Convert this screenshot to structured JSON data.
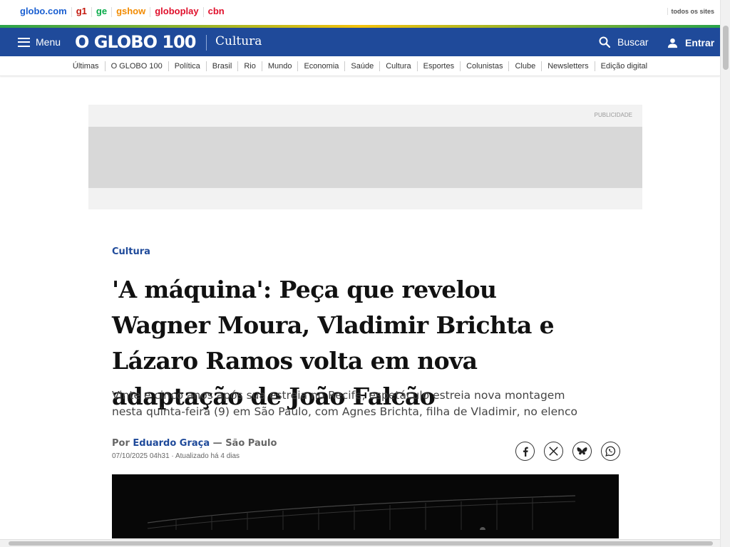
{
  "topbar": {
    "sites": [
      {
        "label": "globo.com",
        "color": "#1a5fd1"
      },
      {
        "label": "g1",
        "color": "#c4170c"
      },
      {
        "label": "ge",
        "color": "#06aa48"
      },
      {
        "label": "gshow",
        "color": "#f28b00"
      },
      {
        "label": "globoplay",
        "color": "#e0102c"
      },
      {
        "label": "cbn",
        "color": "#e0102c"
      }
    ],
    "all_sites_label": "todos os sites"
  },
  "header": {
    "menu_label": "Menu",
    "logo_text": "O GLOBO 100",
    "section_title": "Cultura",
    "search_label": "Buscar",
    "login_label": "Entrar",
    "background_color": "#1f4a9a"
  },
  "subnav": {
    "items": [
      "Últimas",
      "O GLOBO 100",
      "Política",
      "Brasil",
      "Rio",
      "Mundo",
      "Economia",
      "Saúde",
      "Cultura",
      "Esportes",
      "Colunistas",
      "Clube",
      "Newsletters",
      "Edição digital"
    ]
  },
  "ad": {
    "label": "PUBLICIDADE"
  },
  "article": {
    "kicker": "Cultura",
    "headline": "'A máquina': Peça que revelou Wagner Moura, Vladimir Brichta e Lázaro Ramos volta em nova adaptação de João Falcão",
    "subtitle": "Vinte e cinco anos após sua estreia no Recife, espetáculo estreia nova montagem nesta quinta-feira (9) em São Paulo, com Agnes Brichta, filha de Vladimir, no elenco",
    "byline_prefix": "Por",
    "author": "Eduardo Graça",
    "location": "— São Paulo",
    "date": "07/10/2025 04h31 · Atualizado há 4 dias"
  },
  "share": {
    "buttons": [
      "facebook-icon",
      "x-icon",
      "bluesky-icon",
      "whatsapp-icon"
    ]
  }
}
